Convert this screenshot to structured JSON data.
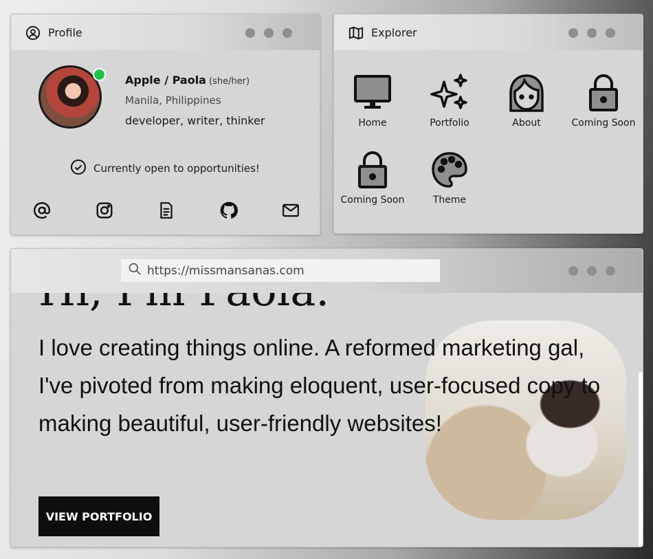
{
  "profile": {
    "title": "Profile",
    "name": "Apple / Paola",
    "pronouns": "(she/her)",
    "location": "Manila, Philippines",
    "description": "developer, writer, thinker",
    "status": "Currently open to opportunities!",
    "online_color": "#1fbf4c",
    "socials": [
      "at-sign-icon",
      "instagram-icon",
      "document-icon",
      "github-icon",
      "mail-icon"
    ]
  },
  "explorer": {
    "title": "Explorer",
    "apps": [
      {
        "label": "Home",
        "icon": "monitor-icon"
      },
      {
        "label": "Portfolio",
        "icon": "sparkles-icon"
      },
      {
        "label": "About",
        "icon": "face-icon"
      },
      {
        "label": "Coming Soon",
        "icon": "lock-icon"
      },
      {
        "label": "Coming Soon",
        "icon": "lock-icon"
      },
      {
        "label": "Theme",
        "icon": "palette-icon"
      }
    ]
  },
  "browser": {
    "url": "https://missmansanas.com",
    "heading": "Hi, I'm Paola.",
    "bio": "I love creating things online. A reformed marketing gal, I've pivoted from making eloquent, user-focused copy to making beautiful, user-friendly websites!",
    "cta": "VIEW PORTFOLIO"
  }
}
